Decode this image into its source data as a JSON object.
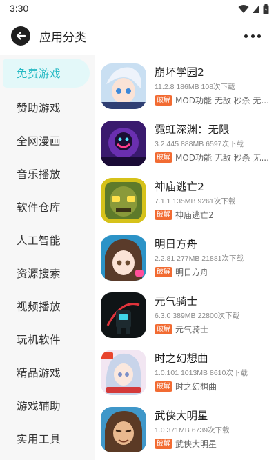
{
  "status_bar": {
    "time": "3:30"
  },
  "header": {
    "title": "应用分类"
  },
  "sidebar": {
    "items": [
      {
        "label": "免费游戏",
        "active": true
      },
      {
        "label": "赞助游戏"
      },
      {
        "label": "全网漫画"
      },
      {
        "label": "音乐播放"
      },
      {
        "label": "软件仓库"
      },
      {
        "label": "人工智能"
      },
      {
        "label": "资源搜索"
      },
      {
        "label": "视频播放"
      },
      {
        "label": "玩机软件"
      },
      {
        "label": "精品游戏"
      },
      {
        "label": "游戏辅助"
      },
      {
        "label": "实用工具"
      }
    ]
  },
  "apps": [
    {
      "name": "崩坏学园2",
      "meta": "11.2.8 186MB 108次下载",
      "badge": "破解",
      "tags": "MOD功能 无敌 秒杀 无..."
    },
    {
      "name": "霓虹深渊：无限",
      "meta": "3.2.445 888MB 6597次下载",
      "badge": "破解",
      "tags": "MOD功能 无敌 秒杀 无..."
    },
    {
      "name": "神庙逃亡2",
      "meta": "7.1.1 135MB 9261次下载",
      "badge": "破解",
      "tags": "神庙逃亡2"
    },
    {
      "name": "明日方舟",
      "meta": "2.2.81 277MB 21881次下载",
      "badge": "破解",
      "tags": "明日方舟"
    },
    {
      "name": "元气骑士",
      "meta": "6.3.0 389MB 22800次下载",
      "badge": "破解",
      "tags": "元气骑士"
    },
    {
      "name": "时之幻想曲",
      "meta": "1.0.101 1013MB 8610次下载",
      "badge": "破解",
      "tags": "时之幻想曲"
    },
    {
      "name": "武侠大明星",
      "meta": "1.0 371MB 6739次下载",
      "badge": "破解",
      "tags": "武侠大明星"
    }
  ],
  "colors": {
    "accent": "#25b9c3",
    "active_bg": "#e3f8f9",
    "badge": "#f26b32"
  }
}
